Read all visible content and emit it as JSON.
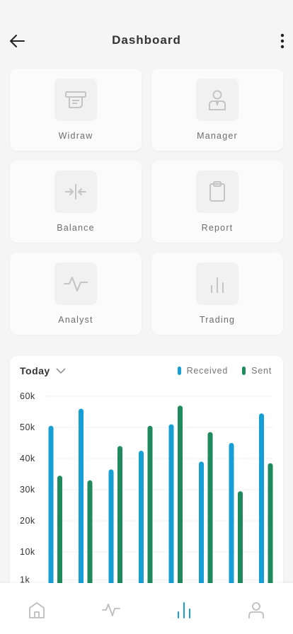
{
  "header": {
    "title": "Dashboard",
    "back_icon": "arrow-left-icon",
    "more_icon": "more-vertical-icon"
  },
  "tiles": [
    {
      "label": "Widraw",
      "icon": "cash-withdraw-icon"
    },
    {
      "label": "Manager",
      "icon": "manager-icon"
    },
    {
      "label": "Balance",
      "icon": "balance-icon"
    },
    {
      "label": "Report",
      "icon": "clipboard-icon"
    },
    {
      "label": "Analyst",
      "icon": "activity-icon"
    },
    {
      "label": "Trading",
      "icon": "bar-chart-icon"
    }
  ],
  "chart": {
    "period": "Today",
    "legend": {
      "received": "Received",
      "sent": "Sent"
    }
  },
  "chart_data": {
    "type": "bar",
    "y_ticks": [
      "60k",
      "50k",
      "40k",
      "30k",
      "20k",
      "10k",
      "1k"
    ],
    "ylim": [
      0,
      60000
    ],
    "grid": true,
    "legend_position": "top-right",
    "series": [
      {
        "name": "Received",
        "color": "#169fd4",
        "values": [
          50500,
          56000,
          36500,
          42500,
          51000,
          39000,
          45000,
          54500
        ]
      },
      {
        "name": "Sent",
        "color": "#1e8a5e",
        "values": [
          34500,
          33000,
          44000,
          50500,
          57000,
          48500,
          29500,
          38500
        ]
      }
    ]
  },
  "tabbar": [
    {
      "name": "tab-home",
      "icon": "home-icon",
      "active": false
    },
    {
      "name": "tab-activity",
      "icon": "activity-icon",
      "active": false
    },
    {
      "name": "tab-stats",
      "icon": "bar-chart-icon",
      "active": true
    },
    {
      "name": "tab-profile",
      "icon": "user-icon",
      "active": false
    }
  ],
  "colors": {
    "accent": "#169fd4",
    "secondary": "#1e8a5e",
    "icon_muted": "#c4c4c4",
    "background": "#f5f5f5"
  }
}
